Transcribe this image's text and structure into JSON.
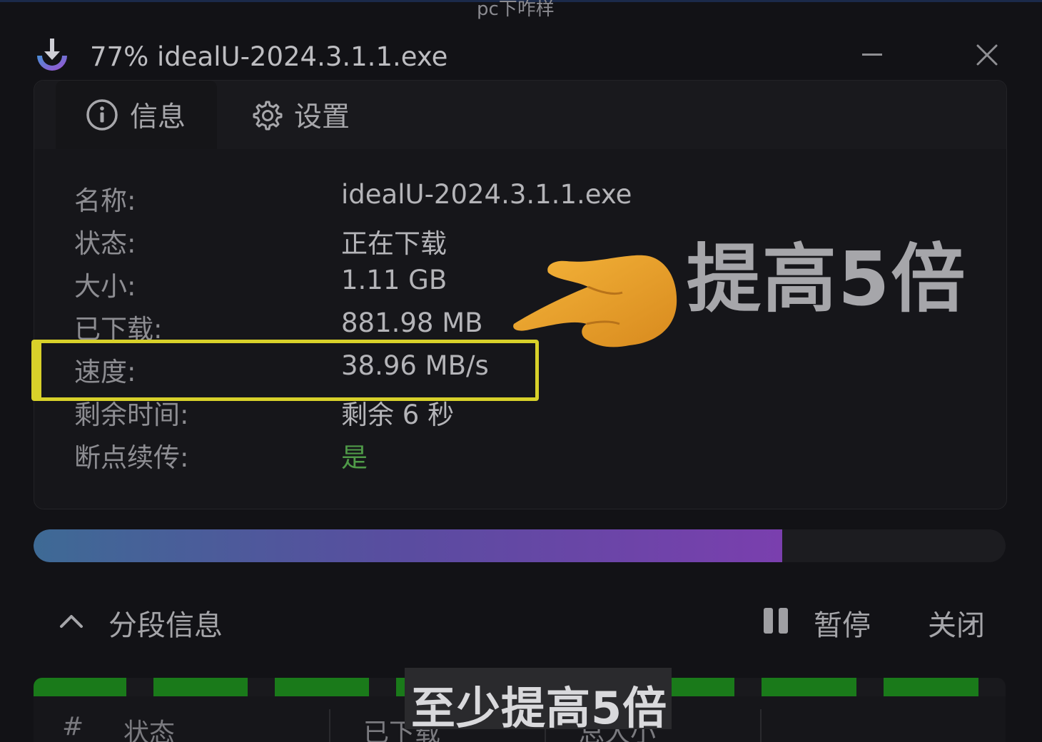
{
  "watermark_top": "pc下咋样",
  "window": {
    "title": "77% idealU-2024.3.1.1.exe"
  },
  "tabs": [
    {
      "label": "信息",
      "icon": "info-icon"
    },
    {
      "label": "设置",
      "icon": "gear-icon"
    }
  ],
  "info": {
    "name": {
      "label": "名称:",
      "value": "idealU-2024.3.1.1.exe"
    },
    "status": {
      "label": "状态:",
      "value": "正在下载"
    },
    "size": {
      "label": "大小:",
      "value": "1.11 GB"
    },
    "downloaded": {
      "label": "已下载:",
      "value": "881.98 MB"
    },
    "speed": {
      "label": "速度:",
      "value": "38.96 MB/s"
    },
    "remaining": {
      "label": "剩余时间:",
      "value": "剩余 6 秒"
    },
    "resume": {
      "label": "断点续传:",
      "value": "是"
    }
  },
  "annotation": {
    "big_text": "提高5倍",
    "subtitle": "至少提高5倍",
    "highlight_color": "#d8d12a"
  },
  "progress": {
    "fraction": 0.77
  },
  "segments": {
    "toggle_label": "分段信息",
    "pause_label": "暂停",
    "close_label": "关闭",
    "columns": [
      "#",
      "状态",
      "已下载",
      "总大小"
    ]
  },
  "colors": {
    "accent_green": "#1a7a1a",
    "resume_green": "#4f9a48",
    "progress_start": "#3e6a95",
    "progress_end": "#7a3fae"
  }
}
